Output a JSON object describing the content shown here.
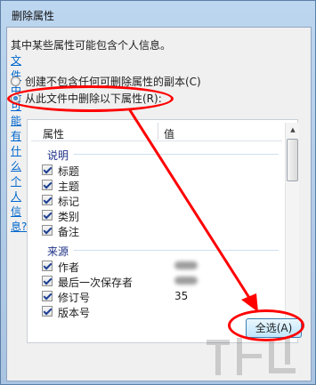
{
  "window": {
    "title": "删除属性"
  },
  "info": {
    "text": "其中某些属性可能包含个人信息。",
    "link": "文件中可能有什么个人信息?"
  },
  "options": [
    {
      "label": "创建不包含任何可删除属性的副本(C)",
      "selected": false
    },
    {
      "label": "从此文件中删除以下属性(R):",
      "selected": true
    }
  ],
  "list": {
    "col_property": "属性",
    "col_value": "值",
    "groups": [
      {
        "name": "说明",
        "items": [
          {
            "label": "标题",
            "value": "",
            "checked": true
          },
          {
            "label": "主题",
            "value": "",
            "checked": true
          },
          {
            "label": "标记",
            "value": "",
            "checked": true
          },
          {
            "label": "类别",
            "value": "",
            "checked": true
          },
          {
            "label": "备注",
            "value": "",
            "checked": true
          }
        ]
      },
      {
        "name": "来源",
        "items": [
          {
            "label": "作者",
            "value": "",
            "checked": true
          },
          {
            "label": "最后一次保存者",
            "value": "",
            "checked": true
          },
          {
            "label": "修订号",
            "value": "35",
            "checked": true
          },
          {
            "label": "版本号",
            "value": "",
            "checked": true
          }
        ]
      }
    ]
  },
  "buttons": {
    "select_all": "全选(A)"
  },
  "annotations": {
    "color": "#ff0000"
  }
}
